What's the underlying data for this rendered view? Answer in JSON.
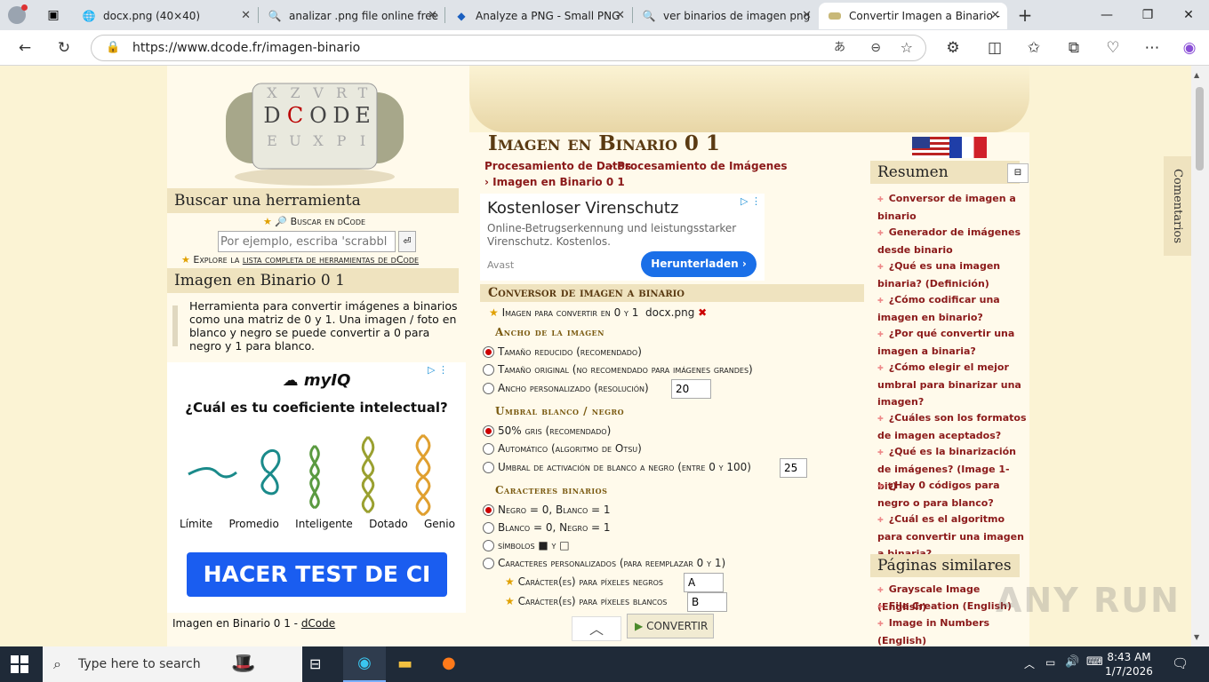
{
  "browser": {
    "tabs": [
      {
        "title": "docx.png (40×40)",
        "icon": "globe-icon"
      },
      {
        "title": "analizar .png file online free",
        "icon": "search-icon"
      },
      {
        "title": "Analyze a PNG - Small PNG",
        "icon": "cube-icon"
      },
      {
        "title": "ver binarios de imagen png",
        "icon": "search-icon"
      },
      {
        "title": "Convertir Imagen a Binario -",
        "icon": "dcode-icon"
      }
    ],
    "url": "https://www.dcode.fr/imagen-binario"
  },
  "left": {
    "search_title": "Buscar una herramienta",
    "search_link": "Buscar en dCode",
    "search_placeholder": "Por ejemplo, escriba 'scrabbl",
    "explore_prefix": "Explore la",
    "explore_link": "lista completa de herramientas de dCode",
    "tool_title": "Imagen en Binario 0 1",
    "tool_desc": "Herramienta para convertir imágenes a binarios como una matriz de 0 y 1. Una imagen / foto en blanco y negro se puede convertir a 0 para negro y 1 para blanco.",
    "ad": {
      "brand": "myIQ",
      "question": "¿Cuál es tu coeficiente intelectual?",
      "levels": [
        "Límite",
        "Promedio",
        "Inteligente",
        "Dotado",
        "Genio"
      ],
      "cta": "HACER TEST DE CI"
    },
    "footer_text": "Imagen en Binario 0 1 -",
    "footer_link": "dCode"
  },
  "main": {
    "title": "Imagen en Binario 0 1",
    "crumbs": [
      "Procesamiento de Datos",
      "Procesamiento de Imágenes",
      "Imagen en Binario 0 1"
    ],
    "ad": {
      "heading": "Kostenloser Virenschutz",
      "text": "Online-Betrugserkennung und leistungsstarker Virenschutz. Kostenlos.",
      "brand": "Avast",
      "button": "Herunterladen"
    },
    "section_title": "Conversor de imagen a binario",
    "image_label": "Imagen para convertir en 0 y 1",
    "image_file": "docx.png",
    "width_title": "Ancho de la imagen",
    "width_opts": [
      "Tamaño reducido (recomendado)",
      "Tamaño original (no recomendado para imágenes grandes)",
      "Ancho personalizado (resolución)"
    ],
    "width_value": "20",
    "thresh_title": "Umbral blanco / negro",
    "thresh_opts": [
      "50% gris (recomendado)",
      "Automático (algoritmo de Otsu)",
      "Umbral de activación de blanco a negro (entre 0 y 100)"
    ],
    "thresh_value": "25",
    "chars_title": "Caracteres binarios",
    "chars_opts": [
      "Negro = 0, Blanco = 1",
      "Blanco = 0, Negro = 1",
      "símbolos ■ y □",
      "Caracteres personalizados (para reemplazar 0 y 1)"
    ],
    "black_label": "Carácter(es) para píxeles negros",
    "black_value": "A",
    "white_label": "Carácter(es) para píxeles blancos",
    "white_value": "B",
    "convert_button": "CONVERTIR"
  },
  "right": {
    "summary_title": "Resumen",
    "summary_links": [
      "Conversor de imagen a binario",
      "Generador de imágenes desde binario",
      "¿Qué es una imagen binaria? (Definición)",
      "¿Cómo codificar una imagen en binario?",
      "¿Por qué convertir una imagen a binaria?",
      "¿Cómo elegir el mejor umbral para binarizar una imagen?",
      "¿Cuáles son los formatos de imagen aceptados?",
      "¿Qué es la binarización de imágenes? (Image 1-bit)",
      "¿Hay 0 códigos para negro o para blanco?",
      "¿Cuál es el algoritmo para convertir una imagen a binaria?"
    ],
    "similar_title": "Páginas similares",
    "similar_links": [
      "Grayscale Image (English)",
      "File Creation (English)",
      "Image in Numbers (English)"
    ],
    "comments_tab": "Comentarios"
  },
  "taskbar": {
    "search_placeholder": "Type here to search",
    "time": "8:43 AM",
    "date": "1/7/2026"
  },
  "watermark": "ANY RUN"
}
